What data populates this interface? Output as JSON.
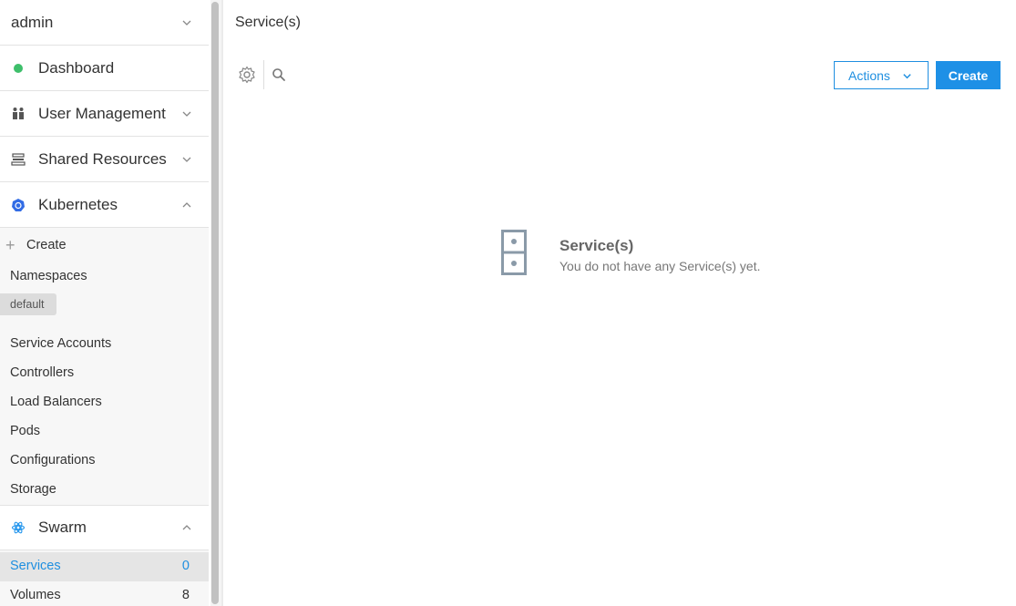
{
  "sidebar": {
    "user": "admin",
    "dashboard": "Dashboard",
    "user_management": "User Management",
    "shared_resources": "Shared Resources",
    "kubernetes": {
      "title": "Kubernetes",
      "create": "Create",
      "namespaces_label": "Namespaces",
      "namespace_value": "default",
      "items": [
        "Service Accounts",
        "Controllers",
        "Load Balancers",
        "Pods",
        "Configurations",
        "Storage"
      ]
    },
    "swarm": {
      "title": "Swarm",
      "items": [
        {
          "label": "Services",
          "count": "0"
        },
        {
          "label": "Volumes",
          "count": "8"
        }
      ]
    }
  },
  "main": {
    "title": "Service(s)",
    "actions_label": "Actions",
    "create_label": "Create",
    "empty_title": "Service(s)",
    "empty_message": "You do not have any Service(s) yet."
  },
  "colors": {
    "accent": "#1e90e6",
    "status_green": "#3ebf6b",
    "kubernetes_blue": "#326ce5",
    "swarm_blue": "#2496ed"
  },
  "icons": [
    "chevron-down-icon",
    "chevron-up-icon",
    "status-dot-icon",
    "users-icon",
    "shared-resources-icon",
    "kubernetes-icon",
    "swarm-icon",
    "plus-icon",
    "gear-icon",
    "search-icon",
    "server-icon"
  ]
}
